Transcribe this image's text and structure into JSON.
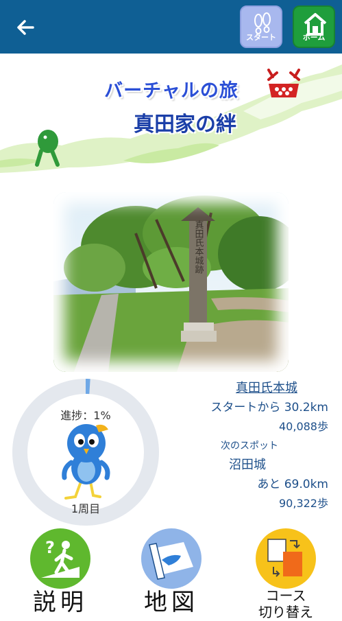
{
  "topbar": {
    "back_icon": "arrow-left-icon",
    "start_label": "スタート",
    "home_label": "ホーム",
    "start_color": "#a8b8ee",
    "home_color": "#1f9e3c",
    "bar_color": "#0f5f94"
  },
  "banner": {
    "title": "バーチャルの旅",
    "subtitle": "真田家の絆"
  },
  "progress": {
    "label": "進捗：1%",
    "percent": 1,
    "lap": "1周目"
  },
  "info": {
    "current_spot": "真田氏本城",
    "from_start": "スタートから 30.2km",
    "steps_done": "40,088歩",
    "next_label": "次のスポット",
    "next_spot": "沼田城",
    "remaining": "あと 69.0km",
    "steps_remaining": "90,322歩"
  },
  "buttons": {
    "explain": "説明",
    "map": "地図",
    "course_line1": "コース",
    "course_line2": "切り替え"
  }
}
